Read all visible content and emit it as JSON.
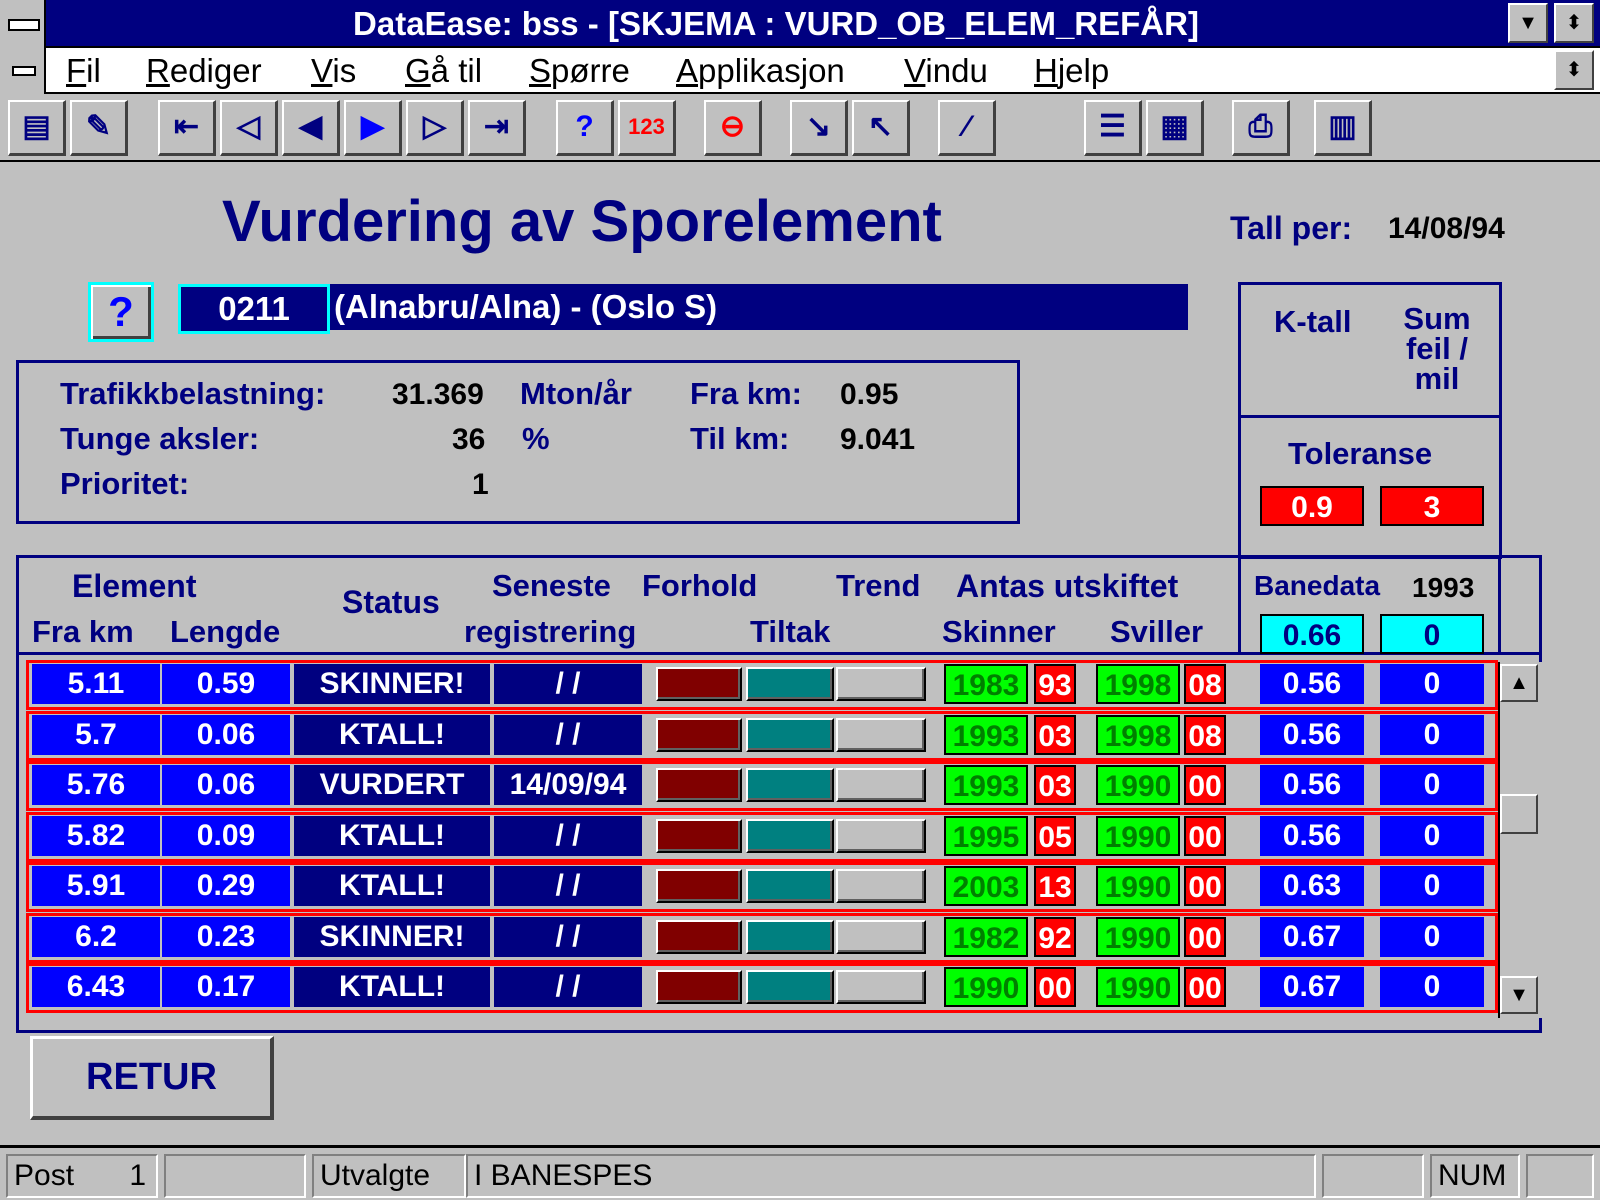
{
  "window": {
    "title": "DataEase: bss - [SKJEMA : VURD_OB_ELEM_REFÅR]",
    "minimize_glyph": "▼",
    "restore_glyph": "⬍"
  },
  "menu": {
    "items": [
      {
        "u": "F",
        "rest": "il"
      },
      {
        "u": "R",
        "rest": "ediger"
      },
      {
        "u": "V",
        "rest": "is"
      },
      {
        "u": "G",
        "rest": "å til"
      },
      {
        "u": "S",
        "rest": "pørre"
      },
      {
        "u": "A",
        "rest": "pplikasjon"
      },
      {
        "u": "V",
        "rest": "indu"
      },
      {
        "u": "H",
        "rest": "jelp"
      }
    ]
  },
  "toolbar": {
    "icons": [
      "new-form-icon",
      "design-icon",
      "first-record-icon",
      "prev-page-icon",
      "prev-record-icon",
      "next-record-icon",
      "next-page-icon",
      "last-record-icon",
      "help-query-icon",
      "sort-icon",
      "search-icon",
      "import-icon",
      "export-icon",
      "edit-icon",
      "form-view-icon",
      "table-view-icon",
      "print-icon",
      "chart-icon"
    ]
  },
  "form": {
    "title": "Vurdering av Sporelement",
    "tall_per_label": "Tall per:",
    "tall_per_value": "14/08/94",
    "help_glyph": "?",
    "code": "0211",
    "route": "(Alnabru/Alna) - (Oslo S)",
    "info": {
      "traffic_label": "Trafikkbelastning:",
      "traffic_value": "31.369",
      "traffic_unit": "Mton/år",
      "heavy_label": "Tunge aksler:",
      "heavy_value": "36",
      "heavy_unit": "%",
      "priority_label": "Prioritet:",
      "priority_value": "1",
      "from_km_label": "Fra km:",
      "from_km_value": "0.95",
      "to_km_label": "Til km:",
      "to_km_value": "9.041"
    },
    "side": {
      "ktall_label": "K-tall",
      "sum_label_1": "Sum",
      "sum_label_2": "feil /",
      "sum_label_3": "mil",
      "toleranse_label": "Toleranse",
      "tol_ktall": "0.9",
      "tol_sum": "3",
      "banedata_label": "Banedata",
      "banedata_year": "1993",
      "banedata_ktall": "0.66",
      "banedata_sum": "0"
    },
    "headers": {
      "element": "Element",
      "fra_km": "Fra km",
      "lengde": "Lengde",
      "status": "Status",
      "seneste": "Seneste",
      "registrering": "registrering",
      "forhold": "Forhold",
      "trend": "Trend",
      "tiltak": "Tiltak",
      "antas": "Antas utskiftet",
      "skinner": "Skinner",
      "sviller": "Sviller"
    },
    "rows": [
      {
        "fra": "5.11",
        "len": "0.59",
        "status": "SKINNER!",
        "reg": "/ /",
        "sk_y": "1983",
        "sk_s": "93",
        "sv_y": "1998",
        "sv_s": "08",
        "kt": "0.56",
        "sum": "0"
      },
      {
        "fra": "5.7",
        "len": "0.06",
        "status": "KTALL!",
        "reg": "/ /",
        "sk_y": "1993",
        "sk_s": "03",
        "sv_y": "1998",
        "sv_s": "08",
        "kt": "0.56",
        "sum": "0"
      },
      {
        "fra": "5.76",
        "len": "0.06",
        "status": "VURDERT",
        "reg": "14/09/94",
        "sk_y": "1993",
        "sk_s": "03",
        "sv_y": "1990",
        "sv_s": "00",
        "kt": "0.56",
        "sum": "0"
      },
      {
        "fra": "5.82",
        "len": "0.09",
        "status": "KTALL!",
        "reg": "/ /",
        "sk_y": "1995",
        "sk_s": "05",
        "sv_y": "1990",
        "sv_s": "00",
        "kt": "0.56",
        "sum": "0"
      },
      {
        "fra": "5.91",
        "len": "0.29",
        "status": "KTALL!",
        "reg": "/ /",
        "sk_y": "2003",
        "sk_s": "13",
        "sv_y": "1990",
        "sv_s": "00",
        "kt": "0.63",
        "sum": "0"
      },
      {
        "fra": "6.2",
        "len": "0.23",
        "status": "SKINNER!",
        "reg": "/ /",
        "sk_y": "1982",
        "sk_s": "92",
        "sv_y": "1990",
        "sv_s": "00",
        "kt": "0.67",
        "sum": "0"
      },
      {
        "fra": "6.43",
        "len": "0.17",
        "status": "KTALL!",
        "reg": "/ /",
        "sk_y": "1990",
        "sk_s": "00",
        "sv_y": "1990",
        "sv_s": "00",
        "kt": "0.67",
        "sum": "0"
      }
    ],
    "button_colors": {
      "forhold": "#800000",
      "trend": "#008080",
      "tiltak": "#c0c0c0"
    },
    "retur_label": "RETUR",
    "scroll_up": "▲",
    "scroll_down": "▼"
  },
  "statusbar": {
    "post_label": "Post",
    "post_value": "1",
    "utvalgte": "Utvalgte",
    "banespes": "I BANESPES",
    "num": "NUM"
  }
}
